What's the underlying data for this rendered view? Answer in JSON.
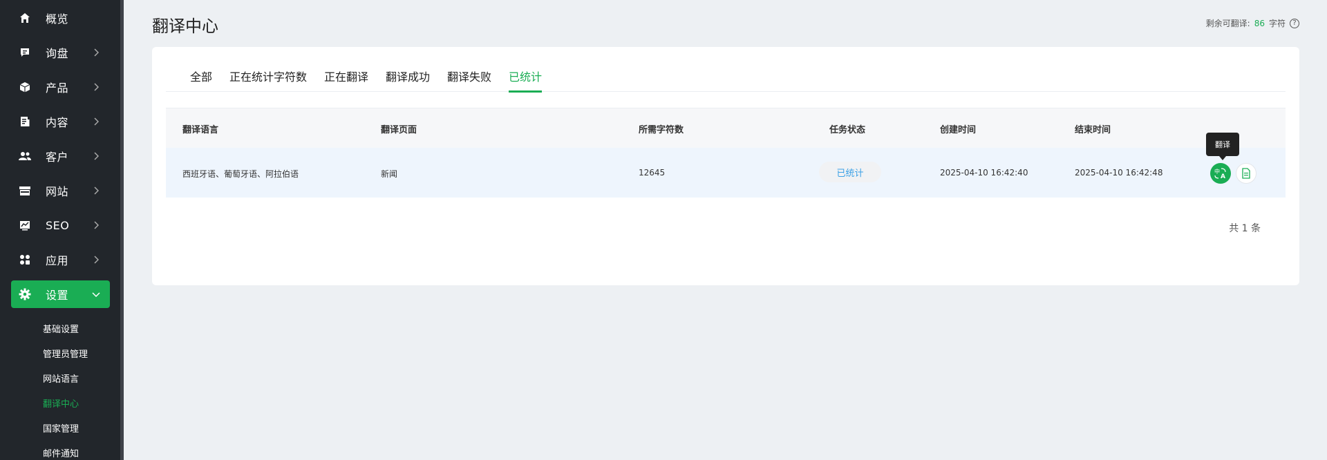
{
  "sidebar": {
    "items": [
      {
        "label": "概览",
        "icon": "home-icon"
      },
      {
        "label": "询盘",
        "icon": "message-icon"
      },
      {
        "label": "产品",
        "icon": "box-icon"
      },
      {
        "label": "内容",
        "icon": "document-icon"
      },
      {
        "label": "客户",
        "icon": "users-icon"
      },
      {
        "label": "网站",
        "icon": "store-icon"
      },
      {
        "label": "SEO",
        "icon": "chart-icon"
      },
      {
        "label": "应用",
        "icon": "apps-icon"
      },
      {
        "label": "设置",
        "icon": "gear-icon"
      }
    ],
    "sub_items": [
      "基础设置",
      "管理员管理",
      "网站语言",
      "翻译中心",
      "国家管理",
      "邮件通知"
    ],
    "active_sub": "翻译中心"
  },
  "header": {
    "title": "翻译中心",
    "quota_label": "剩余可翻译:",
    "quota_value": "86",
    "quota_unit": "字符"
  },
  "tabs": [
    "全部",
    "正在统计字符数",
    "正在翻译",
    "翻译成功",
    "翻译失败",
    "已统计"
  ],
  "active_tab": "已统计",
  "table": {
    "columns": [
      "翻译语言",
      "翻译页面",
      "所需字符数",
      "任务状态",
      "创建时间",
      "结束时间"
    ],
    "rows": [
      {
        "language": "西班牙语、葡萄牙语、阿拉伯语",
        "page": "新闻",
        "chars": "12645",
        "status": "已统计",
        "created": "2025-04-10 16:42:40",
        "ended": "2025-04-10 16:42:48"
      }
    ]
  },
  "tooltip": "翻译",
  "pagination": {
    "total_text": "共 1 条"
  },
  "colors": {
    "accent": "#1aad54",
    "sidebar_bg": "#22262b",
    "status_text": "#3aa0e6"
  }
}
